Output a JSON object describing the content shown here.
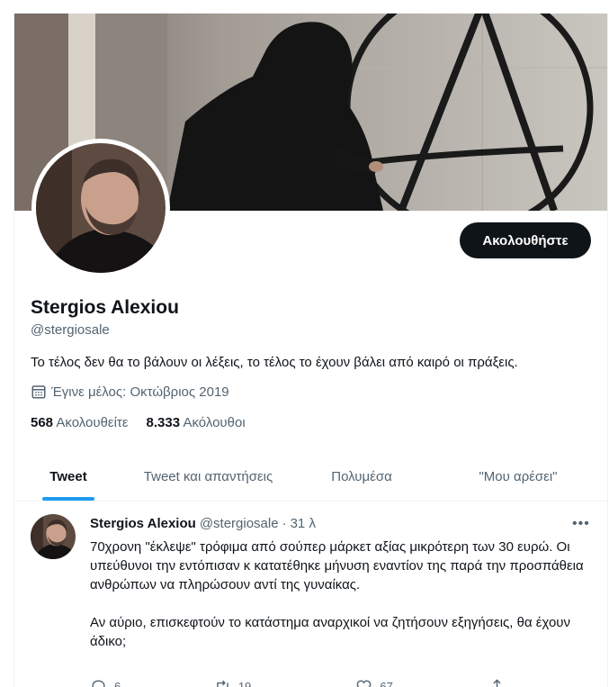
{
  "profile": {
    "name": "Stergios Alexiou",
    "handle": "@stergiosale",
    "bio": "Το τέλος δεν θα το βάλουν οι λέξεις, το τέλος το έχουν βάλει από καιρό οι πράξεις.",
    "joined": "Έγινε μέλος: Οκτώβριος 2019",
    "follow_label": "Ακολουθήστε",
    "following_count": "568",
    "following_label": "Ακολουθείτε",
    "followers_count": "8.333",
    "followers_label": "Ακόλουθοι"
  },
  "tabs": [
    {
      "label": "Tweet",
      "active": true
    },
    {
      "label": "Tweet και απαντήσεις",
      "active": false
    },
    {
      "label": "Πολυμέσα",
      "active": false
    },
    {
      "label": "\"Μου αρέσει\"",
      "active": false
    }
  ],
  "tweet": {
    "author": "Stergios Alexiou",
    "handle": "@stergiosale",
    "separator": "·",
    "time": "31 λ",
    "more": "•••",
    "paragraph1": "70χρονη \"έκλεψε\" τρόφιμα από σούπερ μάρκετ αξίας μικρότερη των 30 ευρώ. Οι υπεύθυνοι την εντόπισαν κ κατατέθηκε μήνυση εναντίον της παρά την προσπάθεια ανθρώπων να πληρώσουν αντί της γυναίκας.",
    "paragraph2": "Αν αύριο, επισκεφτούν το κατάστημα αναρχικοί να ζητήσουν εξηγήσεις, θα έχουν άδικο;",
    "replies": "6",
    "retweets": "19",
    "likes": "67"
  },
  "icons": {
    "calendar": "calendar-icon",
    "reply": "reply-icon",
    "retweet": "retweet-icon",
    "like": "heart-icon",
    "share": "share-icon"
  },
  "colors": {
    "accent": "#1d9bf0",
    "text": "#0f1419",
    "muted": "#536471",
    "button": "#0f1419"
  }
}
